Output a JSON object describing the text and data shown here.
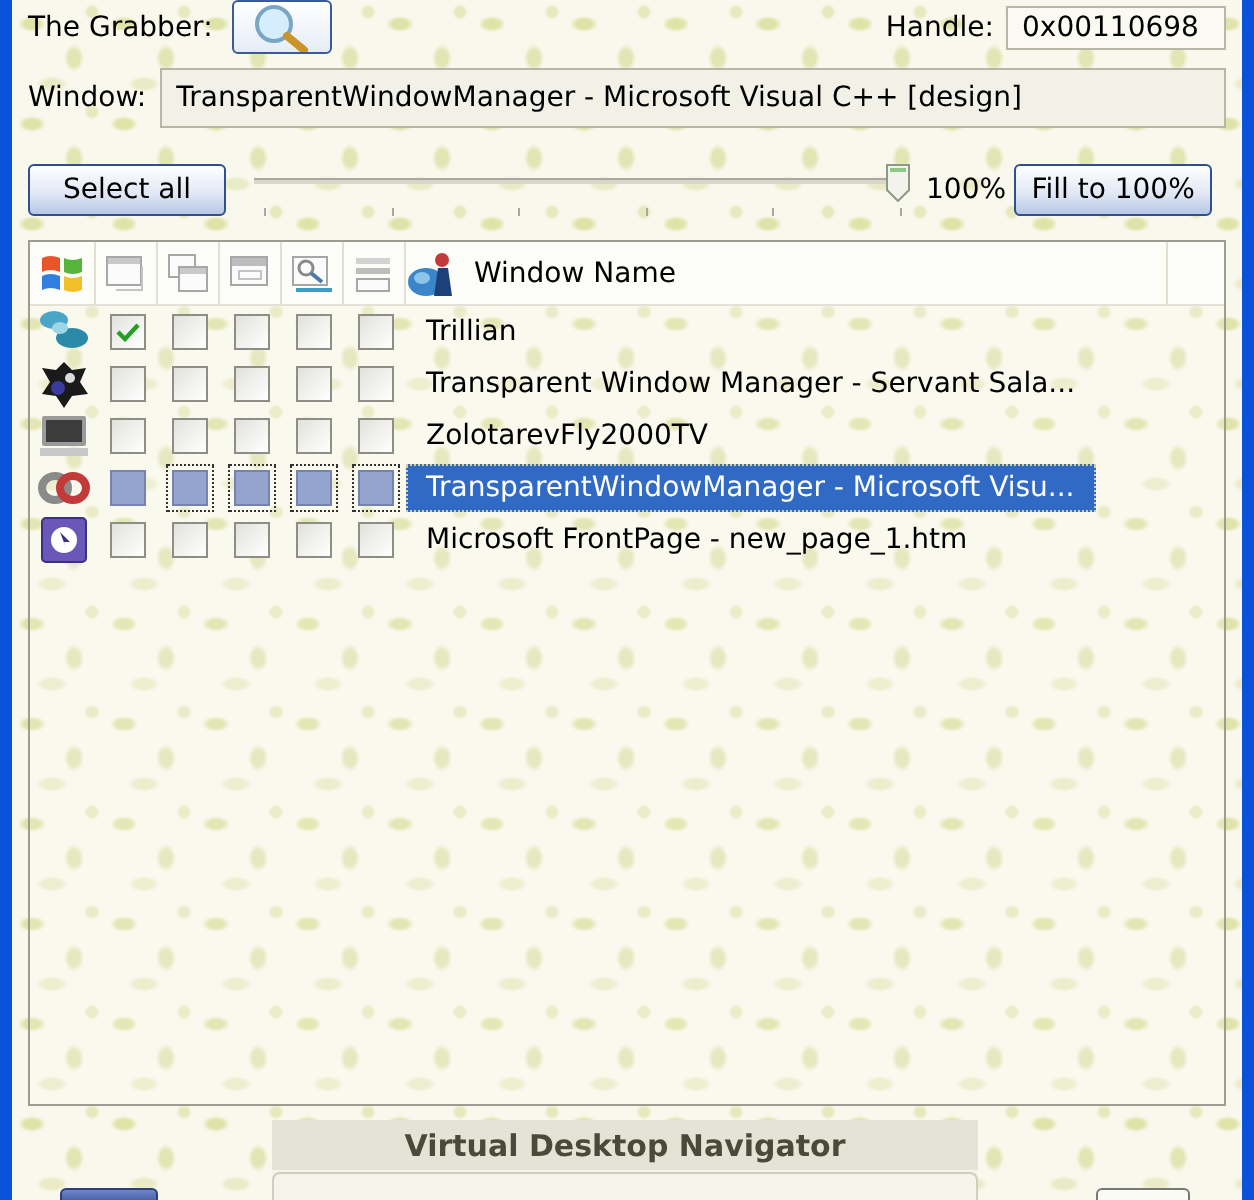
{
  "grabber": {
    "label": "The Grabber:"
  },
  "handle": {
    "label": "Handle:",
    "value": "0x00110698"
  },
  "window": {
    "label": "Window:",
    "value": "TransparentWindowManager - Microsoft Visual C++ [design]"
  },
  "opacity": {
    "select_all": "Select all",
    "level": 1,
    "reading": "100%",
    "fill_button": "Fill to 100%"
  },
  "list": {
    "name_column": "Window Name",
    "rows": [
      {
        "name": "Trillian",
        "checks": [
          true,
          false,
          false,
          false,
          false
        ],
        "selected": false
      },
      {
        "name": "Transparent Window Manager - Servant Sala...",
        "checks": [
          false,
          false,
          false,
          false,
          false
        ],
        "selected": false
      },
      {
        "name": "ZolotarevFly2000TV",
        "checks": [
          false,
          false,
          false,
          false,
          false
        ],
        "selected": false
      },
      {
        "name": "TransparentWindowManager - Microsoft Visu...",
        "checks": [
          false,
          false,
          false,
          false,
          false
        ],
        "selected": true
      },
      {
        "name": "Microsoft FrontPage - new_page_1.htm",
        "checks": [
          false,
          false,
          false,
          false,
          false
        ],
        "selected": false
      }
    ]
  },
  "navigator": {
    "title": "Virtual Desktop Navigator"
  }
}
